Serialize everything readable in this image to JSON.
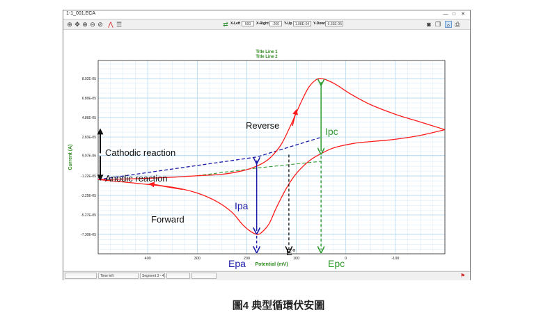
{
  "window": {
    "title": "1-1_001.ECA",
    "minimize": "—",
    "maximize": "□",
    "close": "✕"
  },
  "toolbar": {
    "icons": [
      "zoom-in-icon",
      "move-icon",
      "zoom-area-icon",
      "zoom-out-icon",
      "zoom-reset-icon",
      "peak-icon",
      "list-icon"
    ],
    "xleft_label": "X-Left",
    "xleft_value": "500",
    "xright_label": "X-Right",
    "xright_value": "-200",
    "yup_label": "Y-Up",
    "yup_value": "1.08E-04",
    "ydown_label": "Y-Down",
    "ydown_value": "-9.33E-05",
    "right_icons": [
      "camera-icon",
      "copy-icon",
      "search-icon",
      "printer-icon"
    ]
  },
  "status": {
    "cell1": "",
    "time_label": "Time left",
    "segment_label": "Segment",
    "segment_value": "3 - 4",
    "cell5": "",
    "cell6": ""
  },
  "caption": "圖4 典型循環伏安圖",
  "colors": {
    "curve": "#ff1a1a",
    "grid": "#aad4ee",
    "axis_title": "#2e8b1e",
    "anodic_marker": "#1a1aa8",
    "cathodic_marker": "#2e9b2e",
    "e0_marker": "#111111"
  },
  "chart_data": {
    "type": "line",
    "title": "Title Line 1",
    "subtitle": "Title Line 2",
    "xlabel": "Potential (mV)",
    "ylabel": "Current (A)",
    "xlim": [
      500,
      -200
    ],
    "ylim": [
      -9.33e-05,
      0.000108
    ],
    "x_ticks": [
      400,
      300,
      200,
      100,
      0,
      -100
    ],
    "x_tick_labels": [
      "400",
      "300",
      "200",
      "100",
      "0",
      "-100"
    ],
    "y_ticks": [
      8.92e-05,
      6.89e-05,
      4.86e-05,
      2.83e-05,
      9.07e-06,
      -1.22e-05,
      -3.25e-05,
      -5.27e-05,
      -7.3e-05
    ],
    "y_tick_labels": [
      "8.92E-05",
      "6.89E-05",
      "4.86E-05",
      "2.83E-05",
      "9.07E-06",
      "-1.22E-05",
      "-3.25E-05",
      "-5.27E-05",
      "-7.30E-05"
    ],
    "grid": true,
    "series": [
      {
        "x": [
          500,
          420,
          350,
          300,
          260,
          230,
          210,
          195,
          180,
          170,
          155,
          140,
          120,
          105,
          90,
          70,
          50,
          30,
          10,
          -20,
          -60,
          -100,
          -150,
          -200
        ],
        "y": [
          -1.6e-05,
          -2e-05,
          -2.4e-05,
          -3e-05,
          -3.9e-05,
          -5e-05,
          -6.2e-05,
          -6.9e-05,
          -7.3e-05,
          -7.1e-05,
          -6.2e-05,
          -4.5e-05,
          -2.5e-05,
          -1.3e-05,
          -4e-06,
          5e-06,
          1.1e-05,
          1.6e-05,
          1.9e-05,
          2.2e-05,
          2.4e-05,
          2.6e-05,
          3e-05,
          3.6e-05
        ]
      },
      {
        "x": [
          -200,
          -150,
          -100,
          -50,
          -10,
          20,
          40,
          50,
          60,
          75,
          90,
          110,
          130,
          150,
          165,
          185,
          210,
          250,
          300,
          350,
          420,
          500
        ],
        "y": [
          3.6e-05,
          4.4e-05,
          5.2e-05,
          6.2e-05,
          7.3e-05,
          8.3e-05,
          8.8e-05,
          8.92e-05,
          8.8e-05,
          8e-05,
          6.5e-05,
          4.2e-05,
          2.1e-05,
          8e-06,
          2e-06,
          -3e-06,
          -7e-06,
          -1.05e-05,
          -1.2e-05,
          -1.35e-05,
          -1.5e-05,
          -1.6e-05
        ]
      }
    ],
    "annotations": {
      "reverse": "Reverse",
      "forward": "Forward",
      "cathodic": "Cathodic reaction",
      "anodic": "Anodic reaction",
      "ipa": "Ipa",
      "ipc": "Ipc",
      "epa": "Epa",
      "epc": "Epc",
      "e0": "E°"
    },
    "markers": {
      "epa_x": 180,
      "epc_x": 50,
      "e0_x": 115,
      "ipa_peak_y": -7.3e-05,
      "ipa_base_y": 7.5e-06,
      "ipc_peak_y": 8.92e-05,
      "ipc_base_y": 1e-05,
      "anodic_baseline": {
        "x": [
          500,
          180,
          50
        ],
        "y": [
          -1.6e-05,
          7.5e-06,
          2.8e-05
        ]
      },
      "cathodic_baseline": {
        "x": [
          300,
          180,
          50
        ],
        "y": [
          -1.2e-05,
          -4e-06,
          3e-06
        ]
      },
      "e0_top_y": 1e-05
    }
  }
}
